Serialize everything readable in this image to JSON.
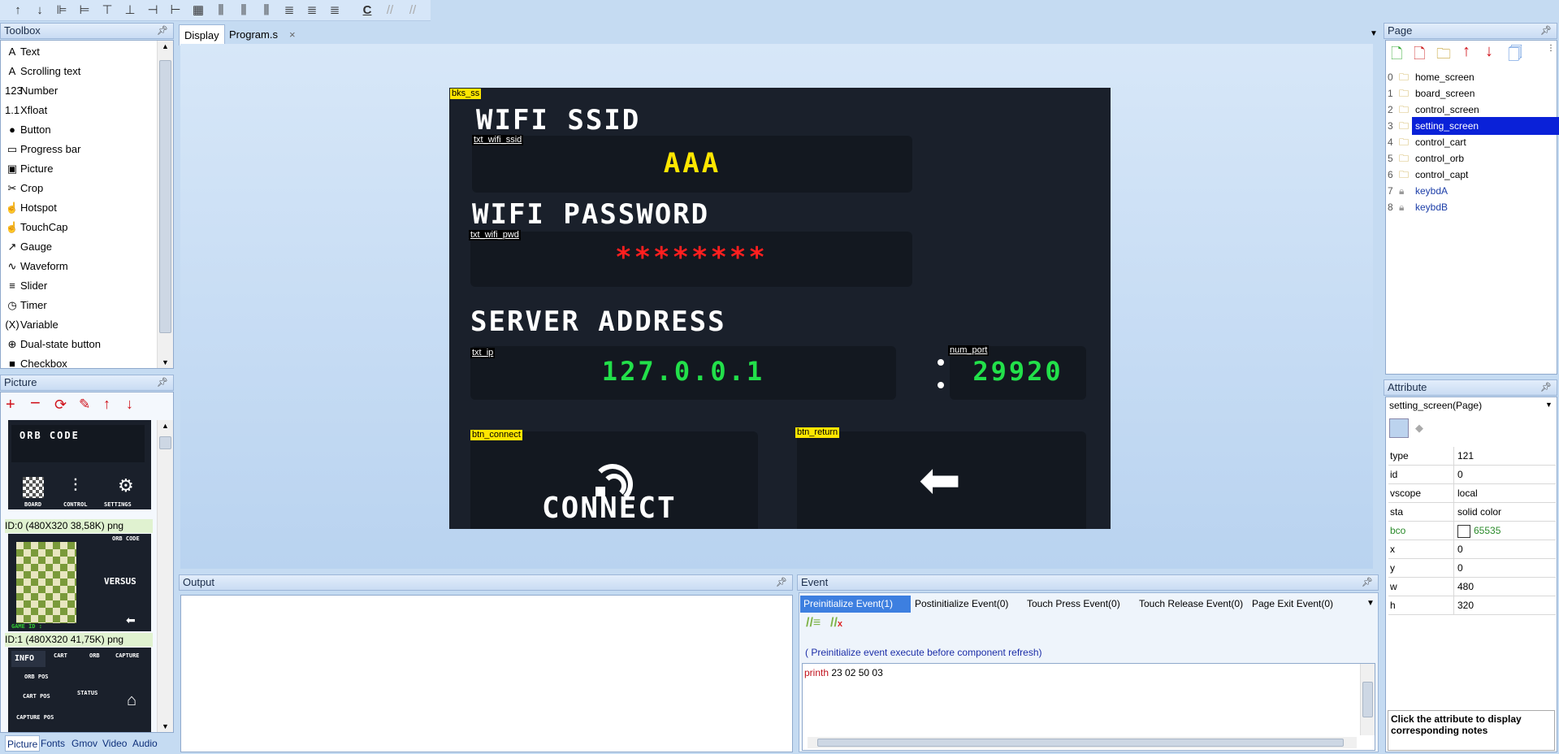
{
  "toolbar": {
    "icons": [
      "move-up-icon",
      "move-down-icon",
      "align-left-icon",
      "align-right-icon",
      "align-top-icon",
      "align-bottom-icon",
      "center-horizontal-icon",
      "center-vertical-icon",
      "grid-icon",
      "distribute-h-icon",
      "distribute-h2-icon",
      "distribute-h3-icon",
      "distribute-v-icon",
      "distribute-v2-icon",
      "distribute-v3-icon",
      "comment-icon",
      "uncomment-icon",
      "clear-comment-icon"
    ],
    "comment_label": "C"
  },
  "toolbox": {
    "title": "Toolbox",
    "items": [
      {
        "label": "Text",
        "icon": "A"
      },
      {
        "label": "Scrolling text",
        "icon": "A"
      },
      {
        "label": "Number",
        "icon": "123"
      },
      {
        "label": "Xfloat",
        "icon": "1.1"
      },
      {
        "label": "Button",
        "icon": "●"
      },
      {
        "label": "Progress bar",
        "icon": "▭"
      },
      {
        "label": "Picture",
        "icon": "▣"
      },
      {
        "label": "Crop",
        "icon": "✂"
      },
      {
        "label": "Hotspot",
        "icon": "☝"
      },
      {
        "label": "TouchCap",
        "icon": "☝"
      },
      {
        "label": "Gauge",
        "icon": "↗"
      },
      {
        "label": "Waveform",
        "icon": "∿"
      },
      {
        "label": "Slider",
        "icon": "≡"
      },
      {
        "label": "Timer",
        "icon": "◷"
      },
      {
        "label": "Variable",
        "icon": "(X)"
      },
      {
        "label": "Dual-state button",
        "icon": "⊕"
      },
      {
        "label": "Checkbox",
        "icon": "■"
      }
    ]
  },
  "picture_panel": {
    "title": "Picture",
    "captions": [
      "ID:0  (480X320 38,58K) png",
      "ID:1  (480X320 41,75K) png"
    ],
    "thumb0": {
      "title": "ORB CODE",
      "btn1": "BOARD",
      "btn2": "CONTROL",
      "btn3": "SETTINGS"
    },
    "thumb1": {
      "code": "ORB CODE",
      "versus": "VERSUS",
      "game": "GAME ID :"
    },
    "thumb2": {
      "tabs": [
        "INFO",
        "CART",
        "ORB",
        "CAPTURE"
      ],
      "l1": "ORB POS",
      "l2": "CART POS",
      "l3": "STATUS",
      "l4": "CAPTURE POS"
    }
  },
  "bottom_tabs": [
    "Picture",
    "Fonts",
    "Gmov",
    "Video",
    "Audio"
  ],
  "editor_tabs": {
    "display": "Display",
    "program": "Program.s",
    "close": "×"
  },
  "screen": {
    "bg_label": "bks_ss",
    "ssid_heading": "WIFI SSID",
    "ssid_label": "txt_wifi_ssid",
    "ssid_value": "AAA",
    "pwd_heading": "WIFI PASSWORD",
    "pwd_label": "txt_wifi_pwd",
    "pwd_value": "********",
    "server_heading": "SERVER ADDRESS",
    "ip_label": "txt_ip",
    "ip_value": "127.0.0.1",
    "port_label": "num_port",
    "port_value": "29920",
    "connect_label": "btn_connect",
    "connect_text": "CONNECT",
    "return_label": "btn_return",
    "colors": {
      "bg": "#1a202b",
      "ssid": "#ffe600",
      "pwd": "#ff1f1f",
      "ip": "#22e04a"
    }
  },
  "output": {
    "title": "Output"
  },
  "event": {
    "title": "Event",
    "tabs": [
      "Preinitialize Event(1)",
      "Postinitialize Event(0)",
      "Touch Press Event(0)",
      "Touch Release Event(0)",
      "Page Exit Event(0)"
    ],
    "hint": "( Preinitialize event execute before component refresh)",
    "code_keyword": "printh",
    "code_args": " 23 02 50 03"
  },
  "page_panel": {
    "title": "Page",
    "pages": [
      {
        "num": "0",
        "name": "home_screen"
      },
      {
        "num": "1",
        "name": "board_screen"
      },
      {
        "num": "2",
        "name": "control_screen"
      },
      {
        "num": "3",
        "name": "setting_screen"
      },
      {
        "num": "4",
        "name": "control_cart"
      },
      {
        "num": "5",
        "name": "control_orb"
      },
      {
        "num": "6",
        "name": "control_capt"
      },
      {
        "num": "7",
        "name": "keybdA"
      },
      {
        "num": "8",
        "name": "keybdB"
      }
    ]
  },
  "attribute_panel": {
    "title": "Attribute",
    "selector": "setting_screen(Page)",
    "rows": [
      {
        "k": "type",
        "v": "121"
      },
      {
        "k": "id",
        "v": "0"
      },
      {
        "k": "vscope",
        "v": "local"
      },
      {
        "k": "sta",
        "v": "solid color"
      },
      {
        "k": "bco",
        "v": "65535"
      },
      {
        "k": "x",
        "v": "0"
      },
      {
        "k": "y",
        "v": "0"
      },
      {
        "k": "w",
        "v": "480"
      },
      {
        "k": "h",
        "v": "320"
      }
    ],
    "note": "Click the attribute to display corresponding notes"
  }
}
